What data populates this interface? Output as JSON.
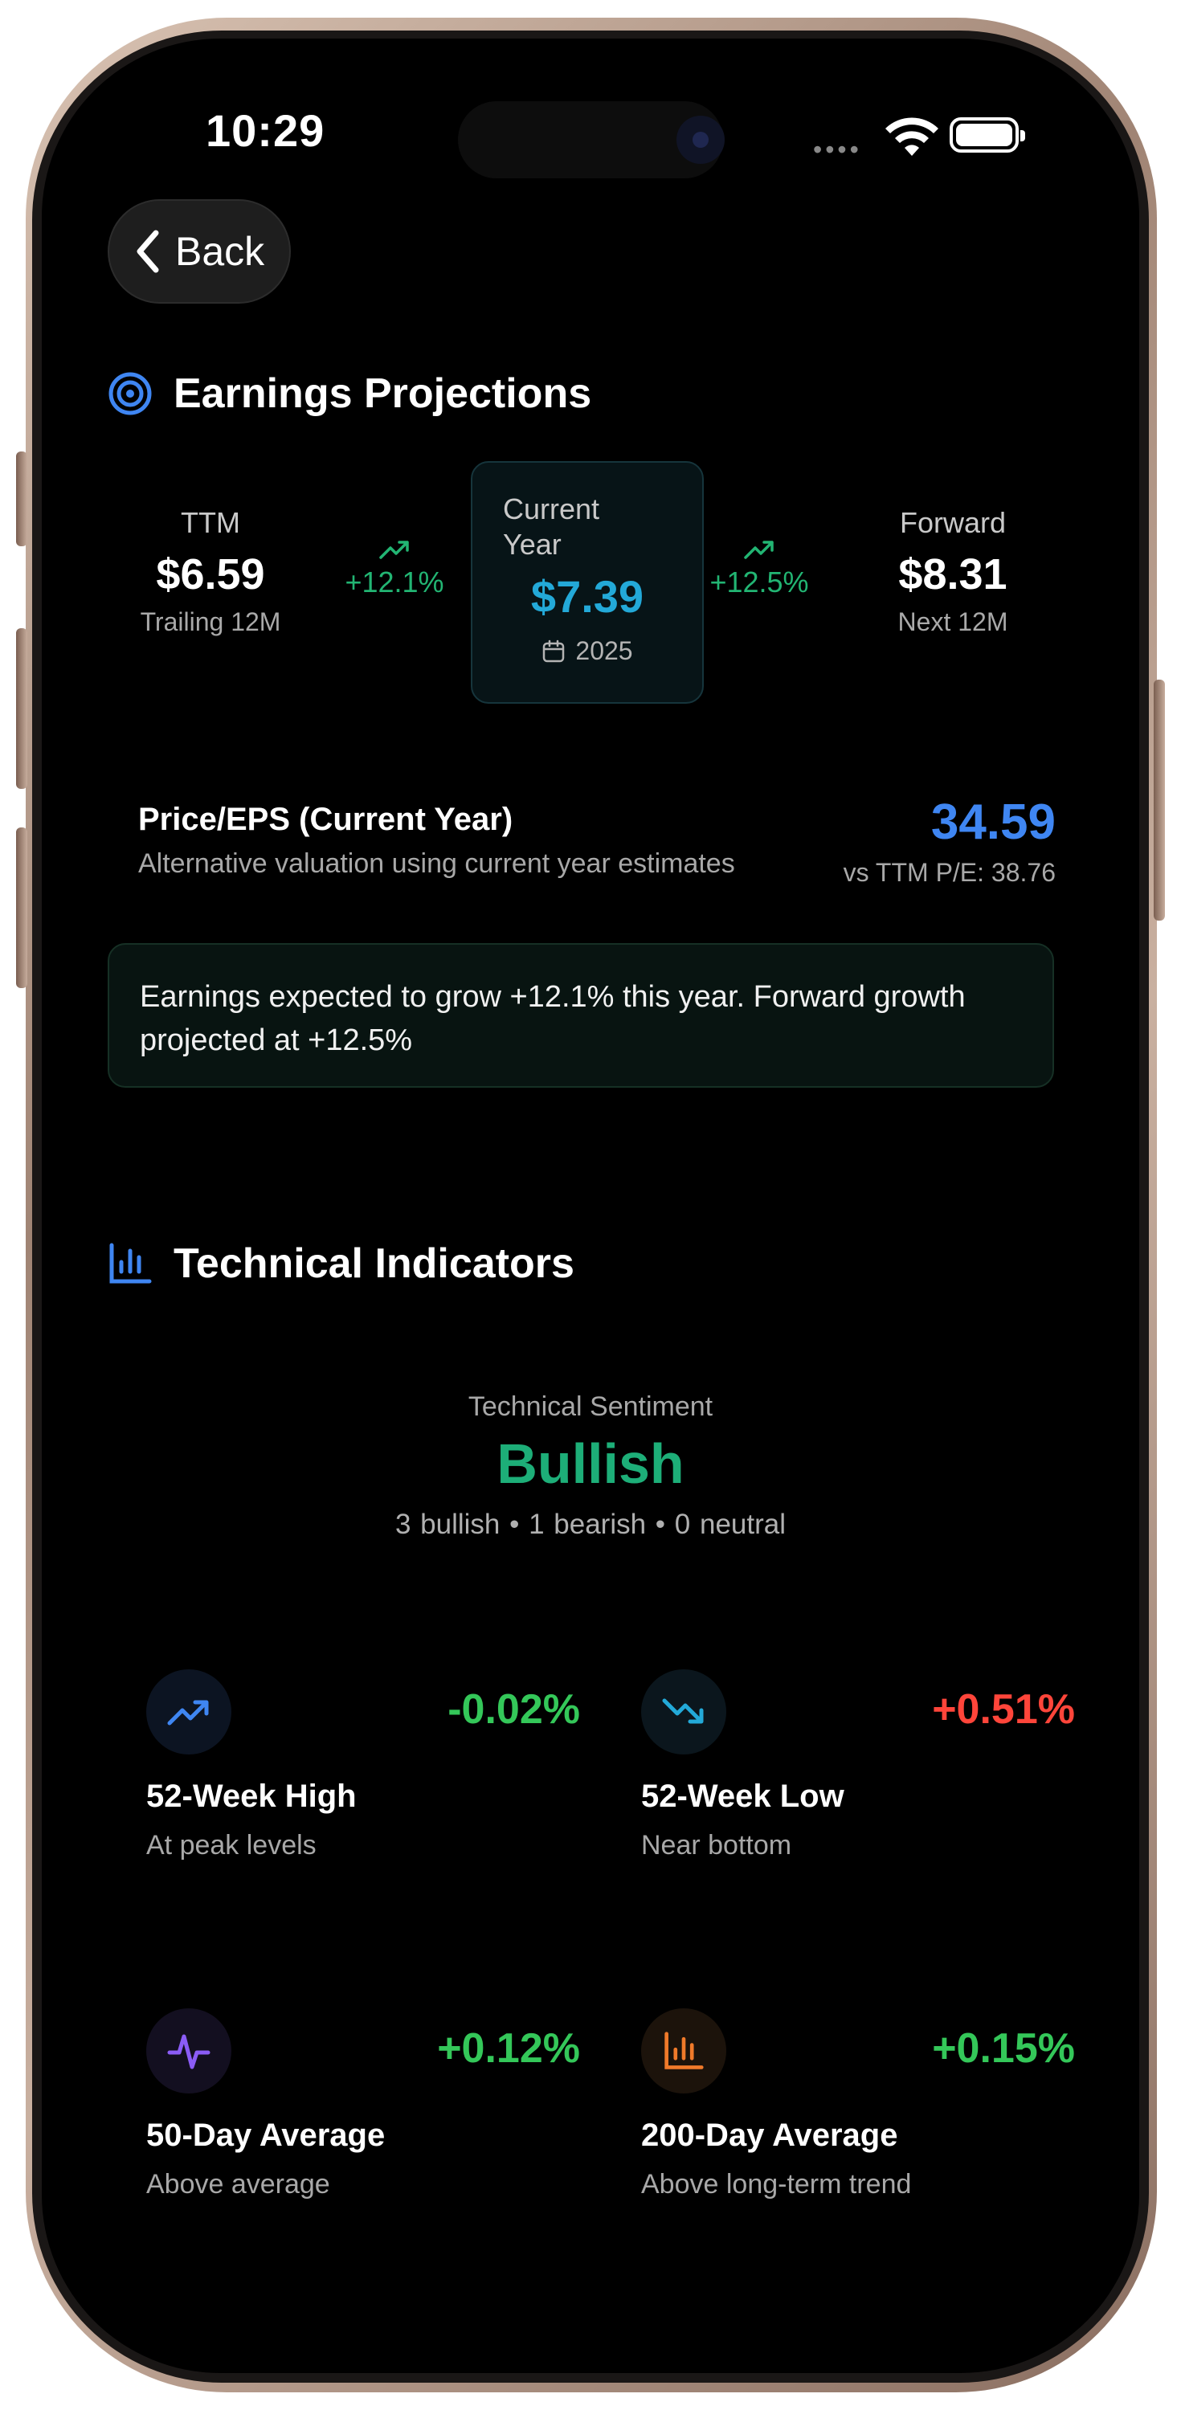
{
  "status_bar": {
    "time": "10:29"
  },
  "nav": {
    "back_label": "Back"
  },
  "earnings": {
    "title": "Earnings Projections",
    "ttm": {
      "label": "TTM",
      "value": "$6.59",
      "sub": "Trailing 12M"
    },
    "growth_to_current": "+12.1%",
    "current": {
      "label": "Current Year",
      "value": "$7.39",
      "year": "2025"
    },
    "growth_to_forward": "+12.5%",
    "forward": {
      "label": "Forward",
      "value": "$8.31",
      "sub": "Next 12M"
    },
    "pe": {
      "title": "Price/EPS (Current Year)",
      "description": "Alternative valuation using current year estimates",
      "value": "34.59",
      "vs_ttm": "vs TTM P/E: 38.76"
    },
    "note": "Earnings expected to grow +12.1% this year. Forward growth projected at +12.5%"
  },
  "technical": {
    "title": "Technical Indicators",
    "sentiment_label": "Technical Sentiment",
    "sentiment_value": "Bullish",
    "sentiment_counts": "3 bullish • 1 bearish • 0 neutral",
    "indicators": [
      {
        "icon": "trending-up-icon",
        "percent": "-0.02%",
        "percent_color": "#34c759",
        "title": "52-Week High",
        "subtitle": "At peak levels"
      },
      {
        "icon": "trending-down-icon",
        "percent": "+0.51%",
        "percent_color": "#ff453a",
        "title": "52-Week Low",
        "subtitle": "Near bottom"
      },
      {
        "icon": "activity-icon",
        "percent": "+0.12%",
        "percent_color": "#34c759",
        "title": "50-Day Average",
        "subtitle": "Above average"
      },
      {
        "icon": "bar-chart-icon",
        "percent": "+0.15%",
        "percent_color": "#34c759",
        "title": "200-Day Average",
        "subtitle": "Above long-term trend"
      }
    ]
  },
  "colors": {
    "accent_blue": "#3f86f2",
    "accent_cyan": "#23a9d8",
    "positive_green": "#22b573",
    "bullish": "#1dae78",
    "negative_red": "#ff453a"
  }
}
